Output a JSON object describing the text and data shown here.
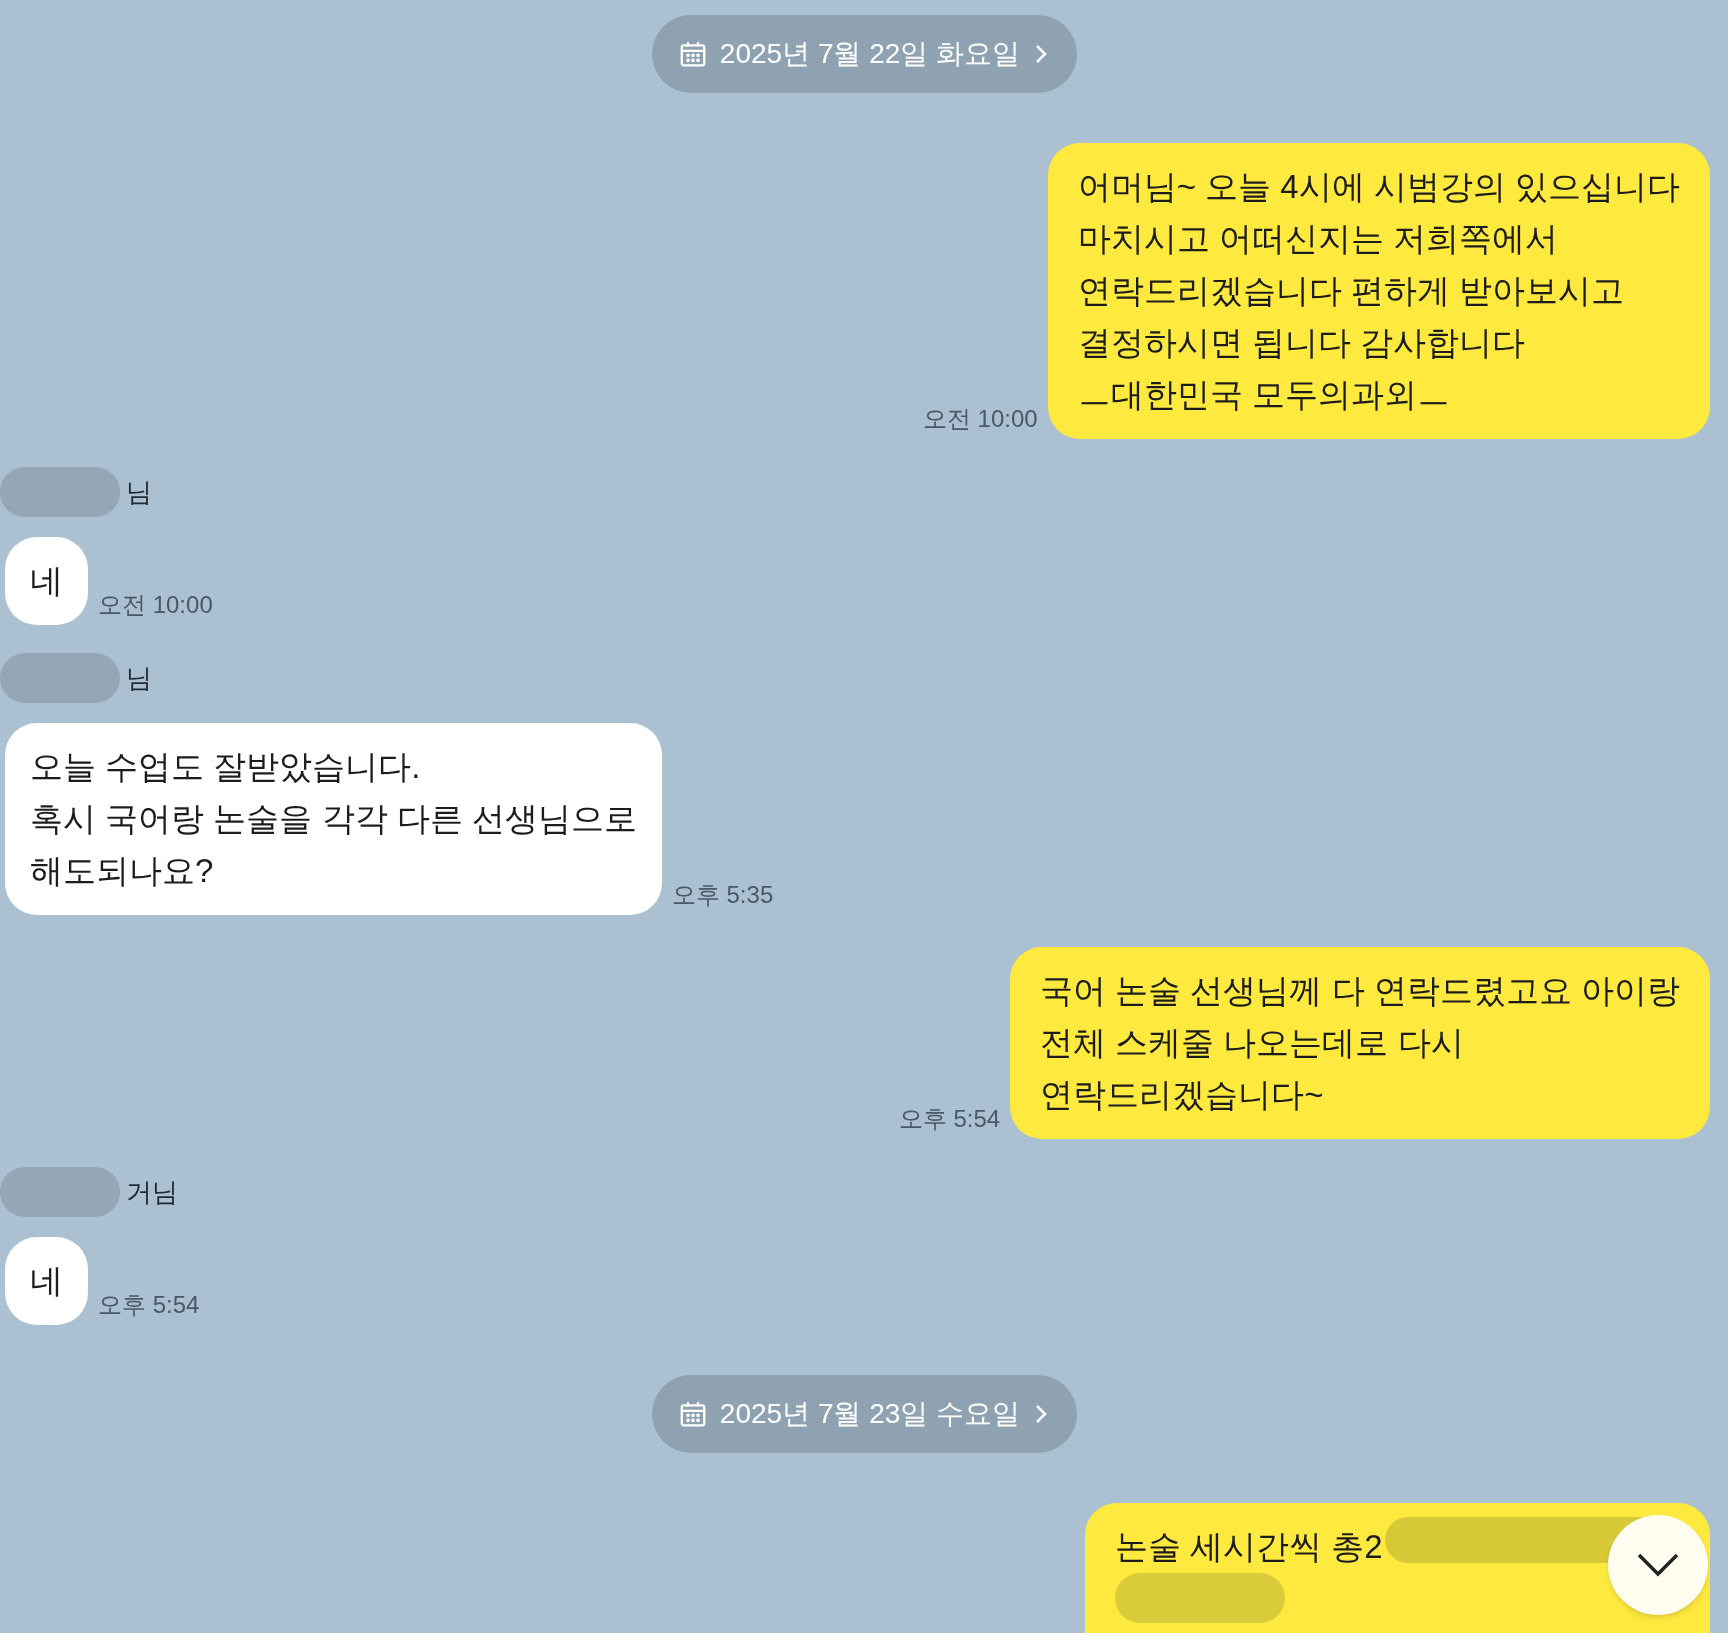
{
  "messages": [
    {
      "kind": "date",
      "text": "2025년 7월 22일 화요일"
    },
    {
      "kind": "outgoing",
      "text": "어머님~ 오늘 4시에 시범강의 있으십니다\n마치시고 어떠신지는 저희쪽에서\n연락드리겠습니다 편하게 받아보시고\n결정하시면 됩니다 감사합니다\nㅡ대한민국 모두의과외ㅡ",
      "time": "오전 10:00"
    },
    {
      "kind": "incoming",
      "sender": "님",
      "redacted": true,
      "text": "네",
      "time": "오전 10:00"
    },
    {
      "kind": "incoming",
      "sender": "님",
      "redacted": true,
      "text": "오늘 수업도 잘받았습니다.\n혹시 국어랑 논술을 각각 다른 선생님으로\n해도되나요?",
      "time": "오후 5:35"
    },
    {
      "kind": "outgoing",
      "text": "국어 논술 선생님께 다 연락드렸고요 아이랑\n전체 스케줄 나오는데로 다시\n연락드리겠습니다~",
      "time": "오후 5:54"
    },
    {
      "kind": "incoming",
      "sender": "거님",
      "redacted": true,
      "text": "네",
      "time": "오후 5:54"
    },
    {
      "kind": "date",
      "text": "2025년 7월 23일 수요일"
    },
    {
      "kind": "outgoing",
      "text": "논술 세시간씩 총2",
      "redacted": true
    }
  ]
}
